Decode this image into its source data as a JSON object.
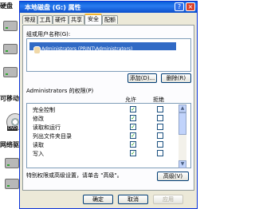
{
  "background": {
    "labels": [
      "硬盘",
      "可移动",
      "网络驱动"
    ],
    "dvd_label": "DVD"
  },
  "window": {
    "title": "本地磁盘 (G:) 属性",
    "help_button": "?",
    "close_button": "×",
    "tabs": [
      {
        "label": "常规",
        "active": false
      },
      {
        "label": "工具",
        "active": false
      },
      {
        "label": "硬件",
        "active": false
      },
      {
        "label": "共享",
        "active": false
      },
      {
        "label": "安全",
        "active": true
      },
      {
        "label": "配额",
        "active": false
      }
    ],
    "groups_label": "组或用户名称(G):",
    "users": [
      {
        "name": "Administrators (PRINT\\Administrators)",
        "selected": true
      }
    ],
    "add_button": "添加(D)...",
    "remove_button": "删除(R)",
    "permissions_label": "Administrators 的权限(P)",
    "allow_header": "允许",
    "deny_header": "拒绝",
    "permissions": [
      {
        "name": "完全控制",
        "allow": true,
        "deny": false
      },
      {
        "name": "修改",
        "allow": true,
        "deny": false
      },
      {
        "name": "读取和运行",
        "allow": true,
        "deny": false
      },
      {
        "name": "列出文件夹目录",
        "allow": true,
        "deny": false
      },
      {
        "name": "读取",
        "allow": true,
        "deny": false
      },
      {
        "name": "写入",
        "allow": true,
        "deny": false
      }
    ],
    "advanced_hint": "特别权限或高级设置，请单击 \"高级\"。",
    "advanced_button": "高级(V)",
    "ok_button": "确定",
    "cancel_button": "取消",
    "apply_button": "应用",
    "scroll_up": "▲",
    "scroll_down": "▼",
    "check_mark": "✓"
  }
}
